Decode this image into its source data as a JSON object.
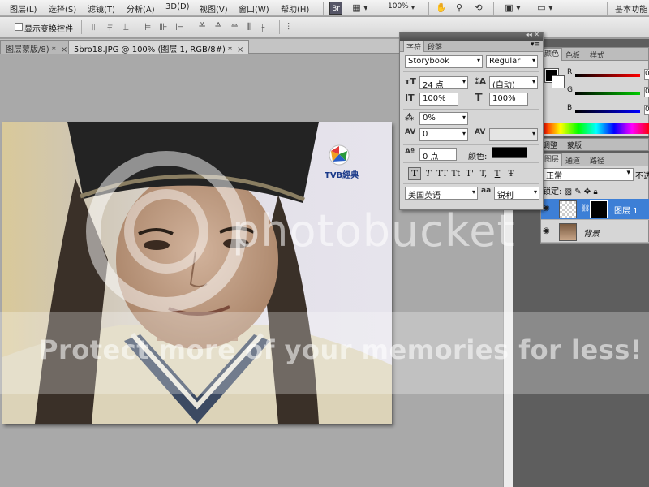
{
  "menubar": {
    "items": [
      "图层(L)",
      "选择(S)",
      "滤镜(T)",
      "分析(A)",
      "3D(D)",
      "视图(V)",
      "窗口(W)",
      "帮助(H)"
    ],
    "br_label": "Br",
    "zoom_level": "100%",
    "workspace_label": "基本功能"
  },
  "options": {
    "show_transform_controls": "显示变换控件"
  },
  "tabs": [
    {
      "label": "图层蒙版/8) *"
    },
    {
      "label": "5bro18.JPG @ 100% (图层 1, RGB/8#) *"
    }
  ],
  "image": {
    "logo_text": "TVB經典"
  },
  "character_panel": {
    "tabs": [
      "字符",
      "段落"
    ],
    "font_family": "Storybook",
    "font_style": "Regular",
    "font_size": "24 点",
    "leading": "(自动)",
    "vertical_scale": "100%",
    "horizontal_scale": "100%",
    "tracking_ratio": "0%",
    "kerning": "0",
    "tracking": "",
    "baseline_shift": "0 点",
    "color_label": "颜色:",
    "color": "#000000",
    "style_buttons": [
      "T",
      "T",
      "TT",
      "Tt",
      "T'",
      "T,",
      "T",
      "Ŧ"
    ],
    "language": "美国英语",
    "aa_icon": "aa",
    "antialias": "锐利"
  },
  "color_panel": {
    "tabs": [
      "颜色",
      "色板",
      "样式"
    ],
    "labels": [
      "R",
      "G",
      "B"
    ],
    "foreground": "#000000",
    "background": "#ffffff",
    "values": [
      "0",
      "0",
      "0"
    ]
  },
  "adjust_panel": {
    "tabs": [
      "调整",
      "蒙版"
    ]
  },
  "layers_panel": {
    "tabs": [
      "图层",
      "通道",
      "路径"
    ],
    "blend_mode": "正常",
    "opacity_label": "不透",
    "lock_label": "锁定:",
    "layers": [
      {
        "name": "图层 1",
        "selected": true
      },
      {
        "name": "背景",
        "selected": false
      }
    ]
  },
  "watermark": {
    "brand": "photobucket",
    "tagline": "Protect more of your memories for less!"
  }
}
